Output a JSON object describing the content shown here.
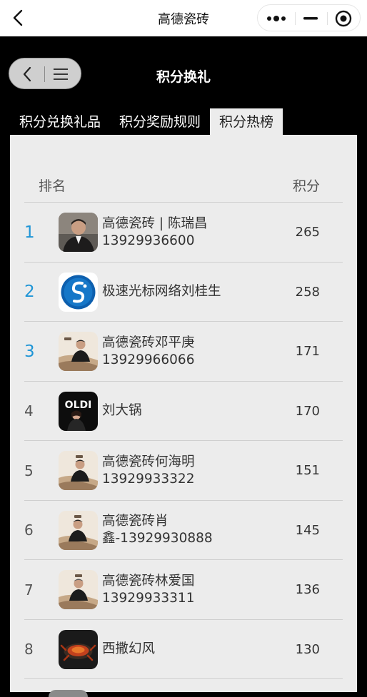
{
  "app": {
    "title": "高德瓷砖"
  },
  "header": {
    "page_title": "积分换礼"
  },
  "tabs": [
    {
      "label": "积分兑换礼品",
      "active": false
    },
    {
      "label": "积分奖励规则",
      "active": false
    },
    {
      "label": "积分热榜",
      "active": true
    }
  ],
  "table": {
    "col_rank": "排名",
    "col_score": "积分",
    "rows": [
      {
        "rank": "1",
        "line1": "高德瓷砖 | 陈瑞昌",
        "line2": "13929936600",
        "score": "265"
      },
      {
        "rank": "2",
        "line1": "极速光标网络刘桂生",
        "line2": "",
        "score": "258"
      },
      {
        "rank": "3",
        "line1": "高德瓷砖邓平庚",
        "line2": "13929966066",
        "score": "171"
      },
      {
        "rank": "4",
        "line1": "刘大锅",
        "line2": "",
        "score": "170"
      },
      {
        "rank": "5",
        "line1": "高德瓷砖何海明",
        "line2": "13929933322",
        "score": "151"
      },
      {
        "rank": "6",
        "line1": "高德瓷砖肖",
        "line2": "鑫-13929930888",
        "score": "145"
      },
      {
        "rank": "7",
        "line1": "高德瓷砖林爱国",
        "line2": "13929933311",
        "score": "136"
      },
      {
        "rank": "8",
        "line1": "西撒幻风",
        "line2": "",
        "score": "130"
      }
    ]
  },
  "avatar_logo_text": "OLDI",
  "colors": {
    "top_rank": "#1f95d6",
    "panel_bg": "#ececec",
    "header_bg": "#000000"
  },
  "icons": {
    "back": "chevron-left-icon",
    "more": "more-dots-icon",
    "minimize": "minimize-icon",
    "close": "target-circle-icon",
    "menu": "hamburger-menu-icon"
  }
}
